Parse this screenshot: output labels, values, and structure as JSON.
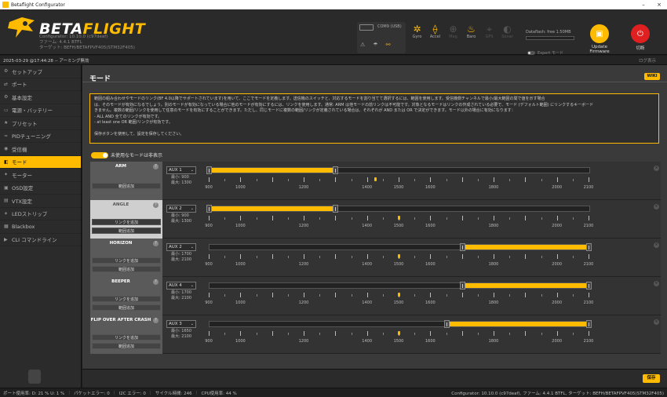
{
  "titlebar": {
    "title": "Betaflight Configurator",
    "minimize": "–",
    "close": "×"
  },
  "header": {
    "brand_a": "BETA",
    "brand_b": "FLIGHT",
    "sub_lines": [
      "Configurator: 10.10.0 (c97deaf)",
      "ファーム: 4.4.1 BTFL",
      "ターゲット: BEFH/BETAFPVF405(STM32F405)"
    ],
    "port_label": "COM9 (USB)",
    "sensors": [
      {
        "icon": "✲",
        "label": "Gyro",
        "on": true
      },
      {
        "icon": "⟠",
        "label": "Accel",
        "on": true
      },
      {
        "icon": "⊕",
        "label": "Mag",
        "on": false
      },
      {
        "icon": "♨",
        "label": "Baro",
        "on": true
      },
      {
        "icon": "⌖",
        "label": "GPS",
        "on": false
      },
      {
        "icon": "◐",
        "label": "Sonar",
        "on": false
      }
    ],
    "dataflash": "Dataflash: free 1.50MB",
    "expert_mode": "Expert モード",
    "update_label": "Update Firmware",
    "disconnect_label": "切断"
  },
  "statusbar_top": {
    "time": "2025-03-29 @17:44:28 -- アーミング無効",
    "log": "ログ表示"
  },
  "nav": [
    {
      "icon": "⚙",
      "label": "セットアップ"
    },
    {
      "icon": "⇄",
      "label": "ポート"
    },
    {
      "icon": "⚙",
      "label": "基本設定"
    },
    {
      "icon": "▭",
      "label": "電源・バッテリー"
    },
    {
      "icon": "★",
      "label": "プリセット"
    },
    {
      "icon": "≈",
      "label": "PIDチューニング"
    },
    {
      "icon": "◉",
      "label": "受信機"
    },
    {
      "icon": "◧",
      "label": "モード"
    },
    {
      "icon": "✦",
      "label": "モーター"
    },
    {
      "icon": "▣",
      "label": "OSD設定"
    },
    {
      "icon": "▤",
      "label": "VTX設定"
    },
    {
      "icon": "✶",
      "label": "LEDストリップ"
    },
    {
      "icon": "▦",
      "label": "Blackbox"
    },
    {
      "icon": "▶",
      "label": "CLI コマンドライン"
    }
  ],
  "page": {
    "title": "モード",
    "wiki": "WIKI",
    "info_lines": [
      "範囲の組み合わせやモードのリンク(BF 4.0以降でサポートされています)を用いて、ここでモードを定義します。送信機のスイッチと、対応するモードを割り当てて選択するには、範囲を使用します。受信機側チャンネルで最小/最大範囲の間で値を示す場合",
      "は、そのモードが有効になるでしょう。別のモードが有効になっている場合に他のモードが有効にするには、リンクを使用します。通常: ARM は他モードの前リンクは不可能です。対象となるモードはリンクの作成されている必要で、モード (デフォルト範囲) にリンクするキーボード",
      "きません。複数の範囲/リンクを使用して任意のモードを有効にすることができます。ただし、同じモードに複数の範囲/リンクが定義されている場合は、それぞれが AND または OR で決定ができます。モード以外の場合に有効になります：",
      "- ALL AND 全てのリンクが有効です。",
      "- at least one OR 範囲/リンクが有効です。",
      "",
      "保存ボタンを使用して、設定を保存してください。"
    ],
    "toggle_label": "未使用なモードは非表示",
    "save": "保存"
  },
  "modes": [
    {
      "name": "ARM",
      "aux": "AUX 1",
      "min": "最小: 900",
      "max": "最大: 1300",
      "range": [
        900,
        1300
      ],
      "marker": 1425,
      "active": false,
      "buttons": [
        "範囲追加"
      ]
    },
    {
      "name": "ANGLE",
      "aux": "AUX 2",
      "min": "最小: 900",
      "max": "最大: 1300",
      "range": [
        900,
        1300
      ],
      "marker": 1500,
      "active": true,
      "buttons": [
        "リンクを追加",
        "範囲追加"
      ]
    },
    {
      "name": "HORIZON",
      "aux": "AUX 2",
      "min": "最小: 1700",
      "max": "最大: 2100",
      "range": [
        1700,
        2100
      ],
      "marker": 1500,
      "active": false,
      "buttons": [
        "リンクを追加",
        "範囲追加"
      ]
    },
    {
      "name": "BEEPER",
      "aux": "AUX 4",
      "min": "最小: 1700",
      "max": "最大: 2100",
      "range": [
        1700,
        2100
      ],
      "marker": 1500,
      "active": false,
      "buttons": [
        "リンクを追加",
        "範囲追加"
      ]
    },
    {
      "name": "FLIP OVER AFTER CRASH",
      "aux": "AUX 3",
      "min": "最小: 1650",
      "max": "最大: 2100",
      "range": [
        1650,
        2100
      ],
      "marker": 1500,
      "active": false,
      "buttons": [
        "リンクを追加",
        "範囲追加"
      ]
    }
  ],
  "scale": {
    "min": 900,
    "max": 2100,
    "labels": [
      "900",
      "1000",
      "1200",
      "1400",
      "1500",
      "1600",
      "1800",
      "2000",
      "2100"
    ],
    "label_values": [
      900,
      1000,
      1200,
      1400,
      1500,
      1600,
      1800,
      2000,
      2100
    ]
  },
  "footer": {
    "items": [
      "ポート使用率: D: 21 % U: 1 %",
      "パケットエラー: 0",
      "I2C エラー: 0",
      "サイクル時間: 246",
      "CPU使用率: 44 %"
    ],
    "right": "Configurator: 10.10.0 (c97deaf), ファーム: 4.4.1 BTFL, ターゲット: BEFH/BETAFPVF405(STM32F405)"
  },
  "colors": {
    "accent": "#ffbb00",
    "disconnect": "#e02020"
  }
}
